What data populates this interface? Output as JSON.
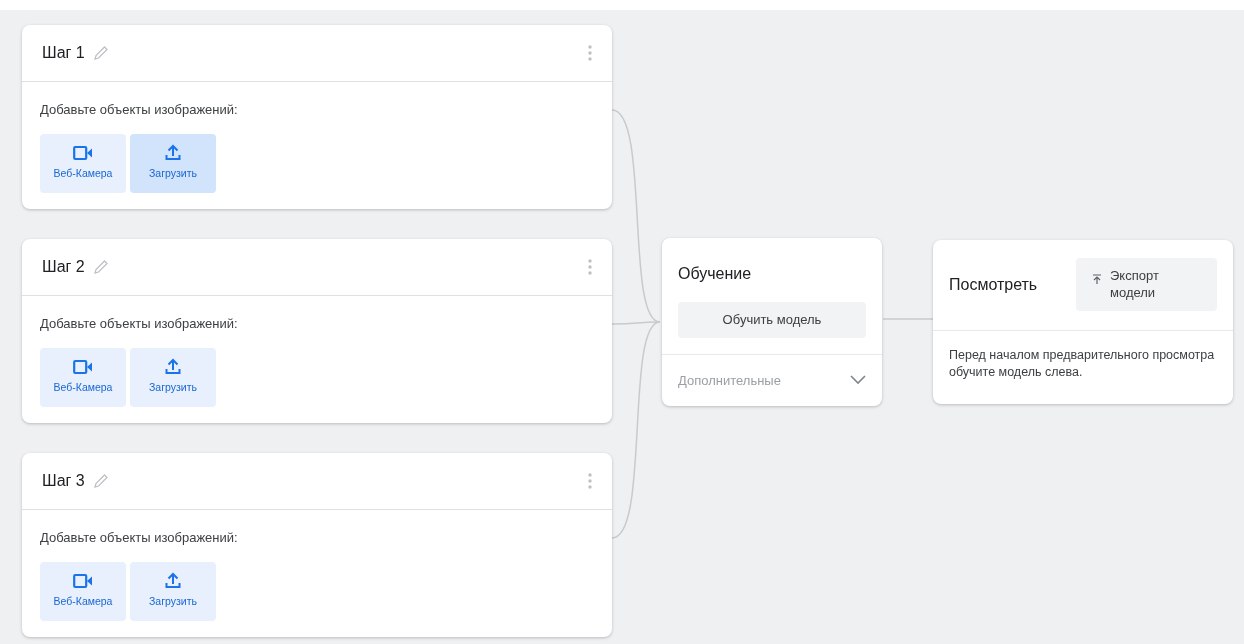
{
  "classes": [
    {
      "title": "Шаг 1",
      "prompt": "Добавьте объекты изображений:",
      "buttons": [
        {
          "kind": "webcam",
          "label": "Веб-Камера",
          "hovered": false
        },
        {
          "kind": "upload",
          "label": "Загрузить",
          "hovered": true
        }
      ]
    },
    {
      "title": "Шаг 2",
      "prompt": "Добавьте объекты изображений:",
      "buttons": [
        {
          "kind": "webcam",
          "label": "Веб-Камера",
          "hovered": false
        },
        {
          "kind": "upload",
          "label": "Загрузить",
          "hovered": false
        }
      ]
    },
    {
      "title": "Шаг 3",
      "prompt": "Добавьте объекты изображений:",
      "buttons": [
        {
          "kind": "webcam",
          "label": "Веб-Камера",
          "hovered": false
        },
        {
          "kind": "upload",
          "label": "Загрузить",
          "hovered": false
        }
      ]
    }
  ],
  "training": {
    "title": "Обучение",
    "button": "Обучить модель",
    "advanced": {
      "label": "Дополнительные",
      "expanded": false
    }
  },
  "preview": {
    "title": "Посмотреть",
    "export_button": "Экспорт модели",
    "message": "Перед началом предварительного просмотра обучите модель слева."
  }
}
